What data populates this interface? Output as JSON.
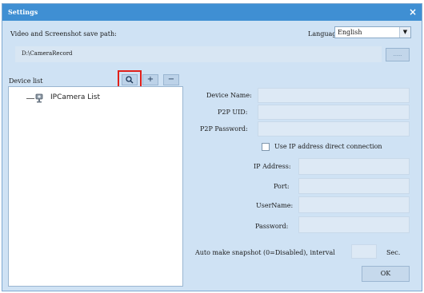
{
  "window": {
    "title": "Settings",
    "close_glyph": "×"
  },
  "paths": {
    "save_path_label": "Video and Screenshot save path:",
    "save_path_value": "D:\\CameraRecord",
    "browse_label": "......"
  },
  "language": {
    "label": "Language",
    "selected": "English",
    "arrow_glyph": "▼"
  },
  "device_list": {
    "label": "Device list",
    "search_icon": "search-icon",
    "add_glyph": "+",
    "remove_glyph": "−",
    "tree_item": "IPCamera List"
  },
  "details": {
    "device_name_label": "Device Name:",
    "p2p_uid_label": "P2P UID:",
    "p2p_password_label": "P2P Password:",
    "use_ip_label": "Use IP address direct connection",
    "ip_address_label": "IP Address:",
    "port_label": "Port:",
    "username_label": "UserName:",
    "password_label": "Password:",
    "snapshot_label": "Auto make snapshot (0=Disabled), interval",
    "snapshot_unit": "Sec.",
    "ok_label": "OK"
  },
  "colors": {
    "titlebar": "#3f8fd3",
    "panel": "#cfe2f4",
    "highlight": "#e0201a"
  }
}
